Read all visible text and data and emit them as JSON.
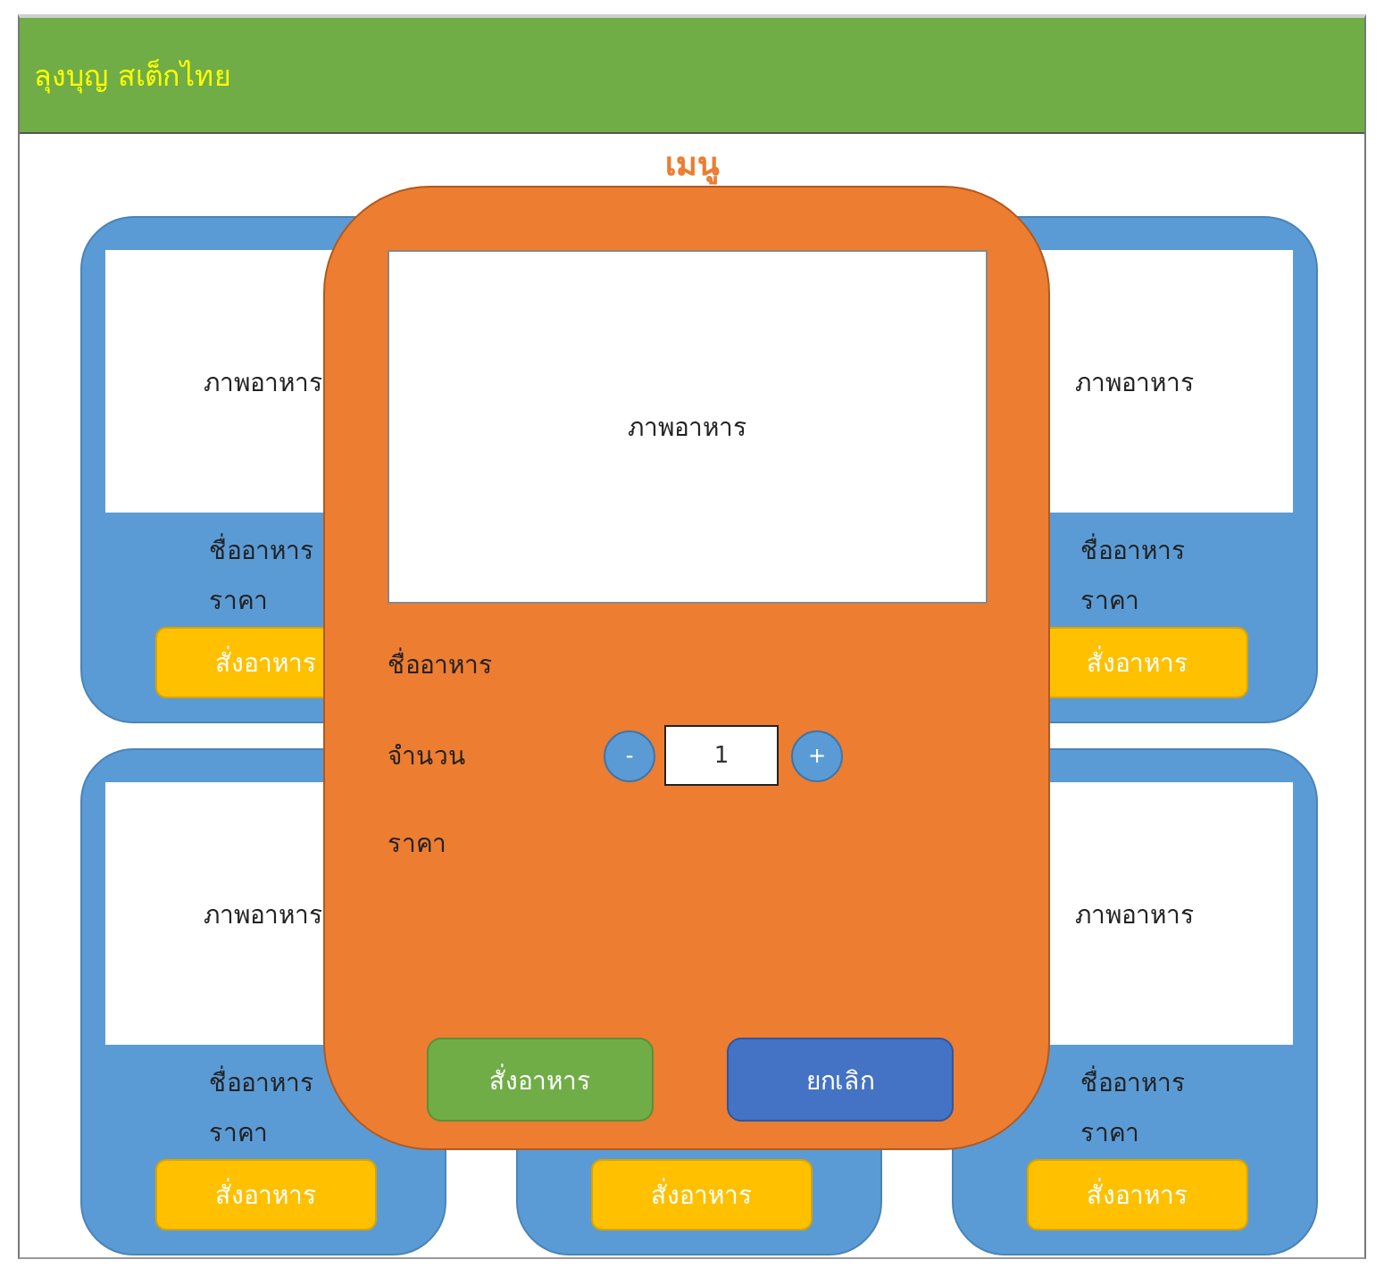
{
  "header": {
    "title": "ลุงบุญ สเต็กไทย"
  },
  "menu_title": "เมนู",
  "menu_rows": [
    {
      "cards": [
        {
          "kind": "item",
          "picture": "ภาพอาหาร",
          "name": "ชื่ออาหาร",
          "price": "ราคา",
          "button": "สั่งอาหาร"
        },
        {
          "kind": "hidden"
        },
        {
          "kind": "item",
          "picture": "ภาพอาหาร",
          "name": "ชื่ออาหาร",
          "price": "ราคา",
          "button": "สั่งอาหาร"
        }
      ]
    },
    {
      "cards": [
        {
          "kind": "item",
          "picture": "ภาพอาหาร",
          "name": "ชื่ออาหาร",
          "price": "ราคา",
          "button": "สั่งอาหาร"
        },
        {
          "kind": "covered",
          "button": "สั่งอาหาร"
        },
        {
          "kind": "item",
          "picture": "ภาพอาหาร",
          "name": "ชื่ออาหาร",
          "price": "ราคา",
          "button": "สั่งอาหาร"
        }
      ]
    }
  ],
  "dialog": {
    "picture": "ภาพอาหาร",
    "name_label": "ชื่ออาหาร",
    "quantity_label": "จำนวน",
    "minus": "-",
    "quantity": "1",
    "plus": "+",
    "price_label": "ราคา",
    "buttons": [
      {
        "kind": "confirm",
        "label": "สั่งอาหาร"
      },
      {
        "kind": "cancel",
        "label": "ยกเลิก"
      }
    ]
  }
}
